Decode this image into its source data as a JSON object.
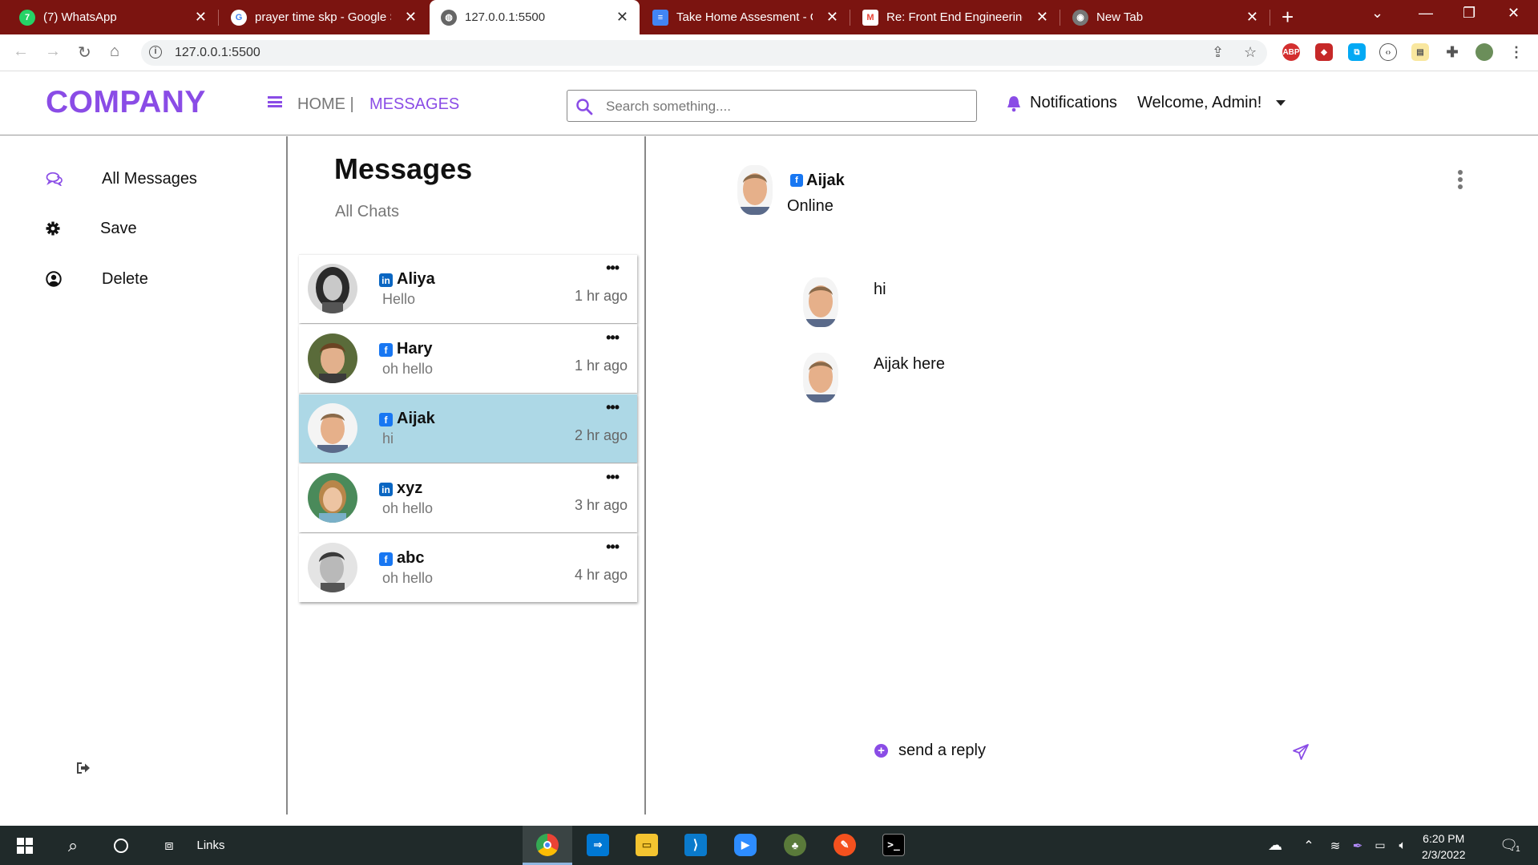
{
  "browser": {
    "tabs": [
      {
        "label": "(7) WhatsApp",
        "icon": "whatsapp-icon",
        "color": "#25d366"
      },
      {
        "label": "prayer time skp - Google Se",
        "icon": "google-icon",
        "color": "#ffffff"
      },
      {
        "label": "127.0.0.1:5500",
        "icon": "globe-icon",
        "color": "#555555"
      },
      {
        "label": "Take Home Assesment - Go",
        "icon": "docs-icon",
        "color": "#4285f4"
      },
      {
        "label": "Re: Front End Engineering",
        "icon": "gmail-icon",
        "color": "#ea4335"
      },
      {
        "label": "New Tab",
        "icon": "chrome-icon",
        "color": "#777777"
      }
    ],
    "url": "127.0.0.1:5500"
  },
  "header": {
    "logo": "COMPANY",
    "nav_home": "HOME |",
    "nav_messages": "MESSAGES",
    "search_placeholder": "Search something....",
    "notifications": "Notifications",
    "welcome": "Welcome, Admin!",
    "accent_color": "#8a4ce6"
  },
  "sidebar": {
    "items": [
      {
        "label": "All Messages",
        "icon": "chat-bubbles-icon"
      },
      {
        "label": "Save",
        "icon": "gear-icon"
      },
      {
        "label": "Delete",
        "icon": "user-circle-icon"
      }
    ],
    "logout_icon": "sign-out-icon"
  },
  "chatlist": {
    "title": "Messages",
    "subtitle": "All Chats",
    "chats": [
      {
        "name": "Aliya",
        "preview": "Hello",
        "time": "1 hr ago",
        "network": "linkedin",
        "active": false
      },
      {
        "name": "Hary",
        "preview": "oh hello",
        "time": "1 hr ago",
        "network": "facebook",
        "active": false
      },
      {
        "name": "Aijak",
        "preview": "hi",
        "time": "2 hr ago",
        "network": "facebook",
        "active": true
      },
      {
        "name": "xyz",
        "preview": "oh hello",
        "time": "3 hr ago",
        "network": "linkedin",
        "active": false
      },
      {
        "name": "abc",
        "preview": "oh hello",
        "time": "4 hr ago",
        "network": "facebook",
        "active": false
      }
    ],
    "active_color": "#add8e6",
    "more_label": "•••"
  },
  "chat": {
    "contact_name": "Aijak",
    "contact_status": "Online",
    "network": "facebook",
    "messages": [
      {
        "text": "hi"
      },
      {
        "text": "Aijak here"
      }
    ],
    "reply_placeholder": "send a reply"
  },
  "taskbar": {
    "search_label": "Links",
    "time": "6:20 PM",
    "date": "2/3/2022",
    "notification_count": "1"
  }
}
